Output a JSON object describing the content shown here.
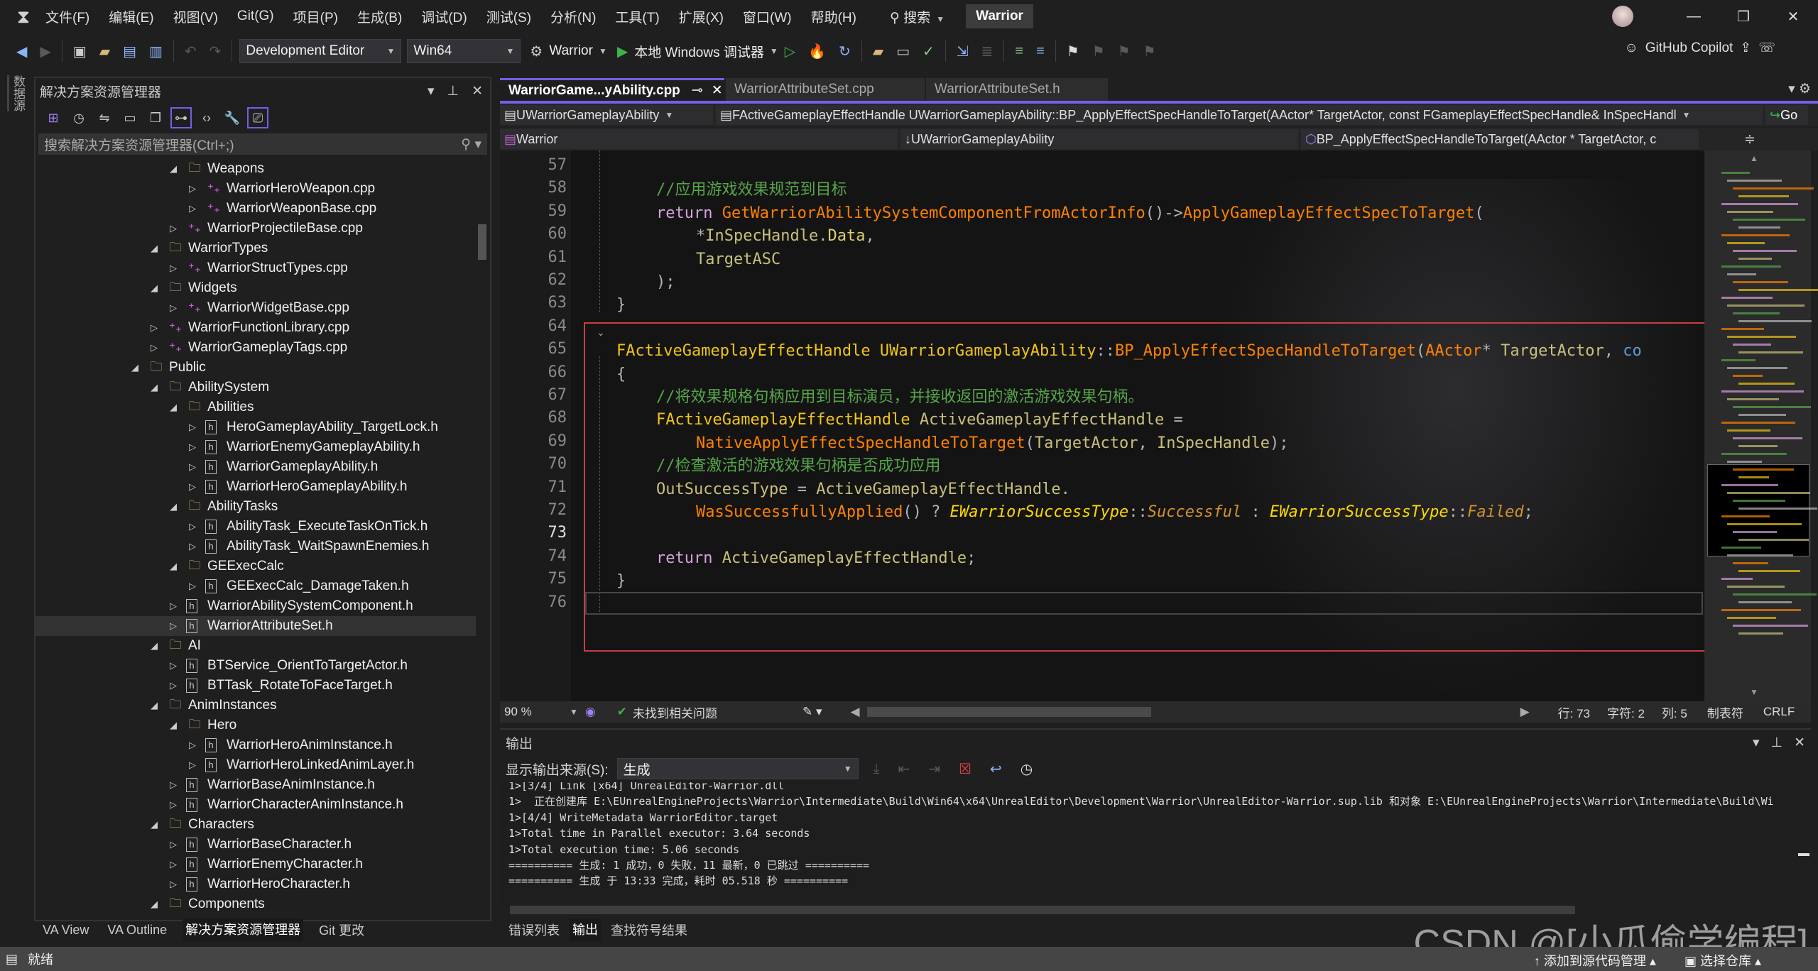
{
  "menubar": {
    "items": [
      "文件(F)",
      "编辑(E)",
      "视图(V)",
      "Git(G)",
      "项目(P)",
      "生成(B)",
      "调试(D)",
      "测试(S)",
      "分析(N)",
      "工具(T)",
      "扩展(X)",
      "窗口(W)",
      "帮助(H)"
    ],
    "search_label": "搜索",
    "title": "Warrior"
  },
  "toolbar": {
    "configuration": "Development Editor",
    "platform": "Win64",
    "startup_project": "Warrior",
    "run_label": "本地 Windows 调试器",
    "copilot_label": "GitHub Copilot"
  },
  "left_strip": {
    "label": "数据源"
  },
  "solution_explorer": {
    "title": "解决方案资源管理器",
    "search_placeholder": "搜索解决方案资源管理器(Ctrl+;)",
    "items": [
      {
        "label": "Weapons",
        "level": 2,
        "kind": "folder",
        "expanded": true
      },
      {
        "label": "WarriorHeroWeapon.cpp",
        "level": 3,
        "kind": "cpp"
      },
      {
        "label": "WarriorWeaponBase.cpp",
        "level": 3,
        "kind": "cpp"
      },
      {
        "label": "WarriorProjectileBase.cpp",
        "level": 2,
        "kind": "cpp"
      },
      {
        "label": "WarriorTypes",
        "level": 1,
        "kind": "folder",
        "expanded": true
      },
      {
        "label": "WarriorStructTypes.cpp",
        "level": 2,
        "kind": "cpp"
      },
      {
        "label": "Widgets",
        "level": 1,
        "kind": "folder",
        "expanded": true
      },
      {
        "label": "WarriorWidgetBase.cpp",
        "level": 2,
        "kind": "cpp"
      },
      {
        "label": "WarriorFunctionLibrary.cpp",
        "level": 1,
        "kind": "cpp"
      },
      {
        "label": "WarriorGameplayTags.cpp",
        "level": 1,
        "kind": "cpp"
      },
      {
        "label": "Public",
        "level": 0,
        "kind": "folder",
        "expanded": true
      },
      {
        "label": "AbilitySystem",
        "level": 1,
        "kind": "folder",
        "expanded": true
      },
      {
        "label": "Abilities",
        "level": 2,
        "kind": "folder",
        "expanded": true
      },
      {
        "label": "HeroGameplayAbility_TargetLock.h",
        "level": 3,
        "kind": "h"
      },
      {
        "label": "WarriorEnemyGameplayAbility.h",
        "level": 3,
        "kind": "h"
      },
      {
        "label": "WarriorGameplayAbility.h",
        "level": 3,
        "kind": "h"
      },
      {
        "label": "WarriorHeroGameplayAbility.h",
        "level": 3,
        "kind": "h"
      },
      {
        "label": "AbilityTasks",
        "level": 2,
        "kind": "folder",
        "expanded": true
      },
      {
        "label": "AbilityTask_ExecuteTaskOnTick.h",
        "level": 3,
        "kind": "h"
      },
      {
        "label": "AbilityTask_WaitSpawnEnemies.h",
        "level": 3,
        "kind": "h"
      },
      {
        "label": "GEExecCalc",
        "level": 2,
        "kind": "folder",
        "expanded": true
      },
      {
        "label": "GEExecCalc_DamageTaken.h",
        "level": 3,
        "kind": "h"
      },
      {
        "label": "WarriorAbilitySystemComponent.h",
        "level": 2,
        "kind": "h"
      },
      {
        "label": "WarriorAttributeSet.h",
        "level": 2,
        "kind": "h",
        "selected": true
      },
      {
        "label": "AI",
        "level": 1,
        "kind": "folder",
        "expanded": true
      },
      {
        "label": "BTService_OrientToTargetActor.h",
        "level": 2,
        "kind": "h"
      },
      {
        "label": "BTTask_RotateToFaceTarget.h",
        "level": 2,
        "kind": "h"
      },
      {
        "label": "AnimInstances",
        "level": 1,
        "kind": "folder",
        "expanded": true
      },
      {
        "label": "Hero",
        "level": 2,
        "kind": "folder",
        "expanded": true
      },
      {
        "label": "WarriorHeroAnimInstance.h",
        "level": 3,
        "kind": "h"
      },
      {
        "label": "WarriorHeroLinkedAnimLayer.h",
        "level": 3,
        "kind": "h"
      },
      {
        "label": "WarriorBaseAnimInstance.h",
        "level": 2,
        "kind": "h"
      },
      {
        "label": "WarriorCharacterAnimInstance.h",
        "level": 2,
        "kind": "h"
      },
      {
        "label": "Characters",
        "level": 1,
        "kind": "folder",
        "expanded": true
      },
      {
        "label": "WarriorBaseCharacter.h",
        "level": 2,
        "kind": "h"
      },
      {
        "label": "WarriorEnemyCharacter.h",
        "level": 2,
        "kind": "h"
      },
      {
        "label": "WarriorHeroCharacter.h",
        "level": 2,
        "kind": "h"
      },
      {
        "label": "Components",
        "level": 1,
        "kind": "folder",
        "expanded": true
      }
    ],
    "bottom_tabs": [
      "VA View",
      "VA Outline",
      "解决方案资源管理器",
      "Git 更改"
    ]
  },
  "editor": {
    "tabs": [
      {
        "label": "WarriorGame...yAbility.cpp",
        "active": true
      },
      {
        "label": "WarriorAttributeSet.cpp"
      },
      {
        "label": "WarriorAttributeSet.h"
      }
    ],
    "nav": {
      "class_combo": "UWarriorGameplayAbility",
      "member_combo": "FActiveGameplayEffectHandle UWarriorGameplayAbility::BP_ApplyEffectSpecHandleToTarget(AActor* TargetActor, const FGameplayEffectSpecHandle& InSpecHandl",
      "go_label": "Go",
      "project_combo": "Warrior",
      "scope_combo": "UWarriorGameplayAbility",
      "symbol_combo": "BP_ApplyEffectSpecHandleToTarget(AActor * TargetActor, c"
    },
    "colors": {
      "comment": "#57a64a",
      "keyword": "#d8a0df",
      "function": "#ff8000",
      "type": "#f0c419",
      "variable": "#c8c07c",
      "member": "#dcd06a",
      "enum_type": "#ffd700",
      "enum_value": "#d0922c",
      "punct": "#b4b4b4",
      "param_keyword": "#569cd6",
      "highlight_border": "#c83c46"
    },
    "current_line": 73,
    "lines": [
      {
        "num": 57,
        "indent": 0,
        "tokens": []
      },
      {
        "num": 58,
        "indent": 1,
        "tokens": [
          {
            "t": "//应用游戏效果规范到目标",
            "c": "comment"
          }
        ]
      },
      {
        "num": 59,
        "indent": 1,
        "tokens": [
          {
            "t": "return ",
            "c": "keyword"
          },
          {
            "t": "GetWarriorAbilitySystemComponentFromActorInfo",
            "c": "function"
          },
          {
            "t": "()->",
            "c": "punct"
          },
          {
            "t": "ApplyGameplayEffectSpecToTarget",
            "c": "function"
          },
          {
            "t": "(",
            "c": "punct"
          }
        ]
      },
      {
        "num": 60,
        "indent": 2,
        "tokens": [
          {
            "t": "*",
            "c": "punct"
          },
          {
            "t": "InSpecHandle",
            "c": "variable"
          },
          {
            "t": ".",
            "c": "punct"
          },
          {
            "t": "Data",
            "c": "member"
          },
          {
            "t": ",",
            "c": "punct"
          }
        ]
      },
      {
        "num": 61,
        "indent": 2,
        "tokens": [
          {
            "t": "TargetASC",
            "c": "variable"
          }
        ]
      },
      {
        "num": 62,
        "indent": 1,
        "tokens": [
          {
            "t": ");",
            "c": "punct"
          }
        ]
      },
      {
        "num": 63,
        "indent": 0,
        "tokens": [
          {
            "t": "}",
            "c": "punct"
          }
        ]
      },
      {
        "num": 64,
        "indent": 0,
        "tokens": []
      },
      {
        "num": 65,
        "indent": 0,
        "tokens": [
          {
            "t": "FActiveGameplayEffectHandle ",
            "c": "type"
          },
          {
            "t": "UWarriorGameplayAbility",
            "c": "type"
          },
          {
            "t": "::",
            "c": "punct"
          },
          {
            "t": "BP_ApplyEffectSpecHandleToTarget",
            "c": "function"
          },
          {
            "t": "(",
            "c": "punct"
          },
          {
            "t": "AActor",
            "c": "function"
          },
          {
            "t": "* ",
            "c": "punct"
          },
          {
            "t": "TargetActor",
            "c": "variable"
          },
          {
            "t": ", ",
            "c": "punct"
          },
          {
            "t": "co",
            "c": "param_keyword"
          }
        ]
      },
      {
        "num": 66,
        "indent": 0,
        "tokens": [
          {
            "t": "{",
            "c": "punct"
          }
        ]
      },
      {
        "num": 67,
        "indent": 1,
        "tokens": [
          {
            "t": "//将效果规格句柄应用到目标演员，并接收返回的激活游戏效果句柄。",
            "c": "comment"
          }
        ]
      },
      {
        "num": 68,
        "indent": 1,
        "tokens": [
          {
            "t": "FActiveGameplayEffectHandle ",
            "c": "type"
          },
          {
            "t": "ActiveGameplayEffectHandle ",
            "c": "variable"
          },
          {
            "t": "=",
            "c": "punct"
          }
        ]
      },
      {
        "num": 69,
        "indent": 2,
        "tokens": [
          {
            "t": "NativeApplyEffectSpecHandleToTarget",
            "c": "function"
          },
          {
            "t": "(",
            "c": "punct"
          },
          {
            "t": "TargetActor",
            "c": "variable"
          },
          {
            "t": ", ",
            "c": "punct"
          },
          {
            "t": "InSpecHandle",
            "c": "variable"
          },
          {
            "t": ");",
            "c": "punct"
          }
        ]
      },
      {
        "num": 70,
        "indent": 1,
        "tokens": [
          {
            "t": "//检查激活的游戏效果句柄是否成功应用",
            "c": "comment"
          }
        ]
      },
      {
        "num": 71,
        "indent": 1,
        "tokens": [
          {
            "t": "OutSuccessType ",
            "c": "variable"
          },
          {
            "t": "= ",
            "c": "punct"
          },
          {
            "t": "ActiveGameplayEffectHandle",
            "c": "variable"
          },
          {
            "t": ".",
            "c": "punct"
          }
        ]
      },
      {
        "num": 72,
        "indent": 2,
        "tokens": [
          {
            "t": "WasSuccessfullyApplied",
            "c": "function"
          },
          {
            "t": "() ? ",
            "c": "punct"
          },
          {
            "t": "EWarriorSuccessType",
            "c": "enum_type"
          },
          {
            "t": "::",
            "c": "punct"
          },
          {
            "t": "Successful",
            "c": "enum_value"
          },
          {
            "t": " : ",
            "c": "punct"
          },
          {
            "t": "EWarriorSuccessType",
            "c": "enum_type"
          },
          {
            "t": "::",
            "c": "punct"
          },
          {
            "t": "Failed",
            "c": "enum_value"
          },
          {
            "t": ";",
            "c": "punct"
          }
        ]
      },
      {
        "num": 73,
        "indent": 0,
        "tokens": []
      },
      {
        "num": 74,
        "indent": 1,
        "tokens": [
          {
            "t": "return ",
            "c": "keyword"
          },
          {
            "t": "ActiveGameplayEffectHandle",
            "c": "variable"
          },
          {
            "t": ";",
            "c": "punct"
          }
        ]
      },
      {
        "num": 75,
        "indent": 0,
        "tokens": [
          {
            "t": "}",
            "c": "punct"
          }
        ]
      },
      {
        "num": 76,
        "indent": 0,
        "tokens": []
      }
    ],
    "status": {
      "zoom": "90 %",
      "issues": "未找到相关问题",
      "line": "行: 73",
      "char": "字符: 2",
      "col": "列: 5",
      "indent": "制表符",
      "eol": "CRLF"
    }
  },
  "output": {
    "title": "输出",
    "source_label": "显示输出来源(S):",
    "source_value": "生成",
    "lines": [
      "1>[3/4] Link [x64] UnrealEditor-Warrior.dll",
      "1>  正在创建库 E:\\EUnrealEngineProjects\\Warrior\\Intermediate\\Build\\Win64\\x64\\UnrealEditor\\Development\\Warrior\\UnrealEditor-Warrior.sup.lib 和对象 E:\\EUnrealEngineProjects\\Warrior\\Intermediate\\Build\\Wi",
      "1>[4/4] WriteMetadata WarriorEditor.target",
      "1>Total time in Parallel executor: 3.64 seconds",
      "1>Total execution time: 5.06 seconds",
      "========== 生成: 1 成功，0 失败，11 最新，0 已跳过 ==========",
      "========== 生成 于 13:33 完成，耗时 05.518 秒 =========="
    ],
    "bottom_tabs": [
      "错误列表",
      "输出",
      "查找符号结果"
    ]
  },
  "statusbar": {
    "ready": "就绪",
    "add_source": "添加到源代码管理",
    "select_repo": "选择仓库"
  },
  "watermark": "CSDN @[小瓜偷学编程]"
}
